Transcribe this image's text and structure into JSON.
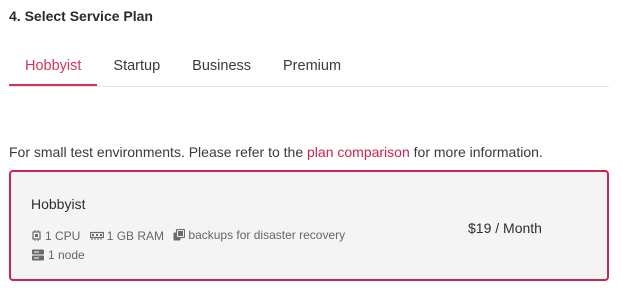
{
  "section": {
    "title": "4. Select Service Plan"
  },
  "tabs": [
    {
      "label": "Hobbyist",
      "active": true
    },
    {
      "label": "Startup",
      "active": false
    },
    {
      "label": "Business",
      "active": false
    },
    {
      "label": "Premium",
      "active": false
    }
  ],
  "description": {
    "before": "For small test environments. Please refer to the ",
    "link": "plan comparison",
    "after": " for more information."
  },
  "plan": {
    "name": "Hobbyist",
    "specs": [
      {
        "icon": "cpu-icon",
        "label": "1 CPU"
      },
      {
        "icon": "memory-icon",
        "label": "1 GB RAM"
      },
      {
        "icon": "backup-icon",
        "label": "backups for disaster recovery"
      },
      {
        "icon": "server-icon",
        "label": "1 node"
      }
    ],
    "price": "$19 / Month"
  },
  "colors": {
    "accent": "#c9254f",
    "card_background": "#f4f4f4",
    "text": "#333333"
  }
}
